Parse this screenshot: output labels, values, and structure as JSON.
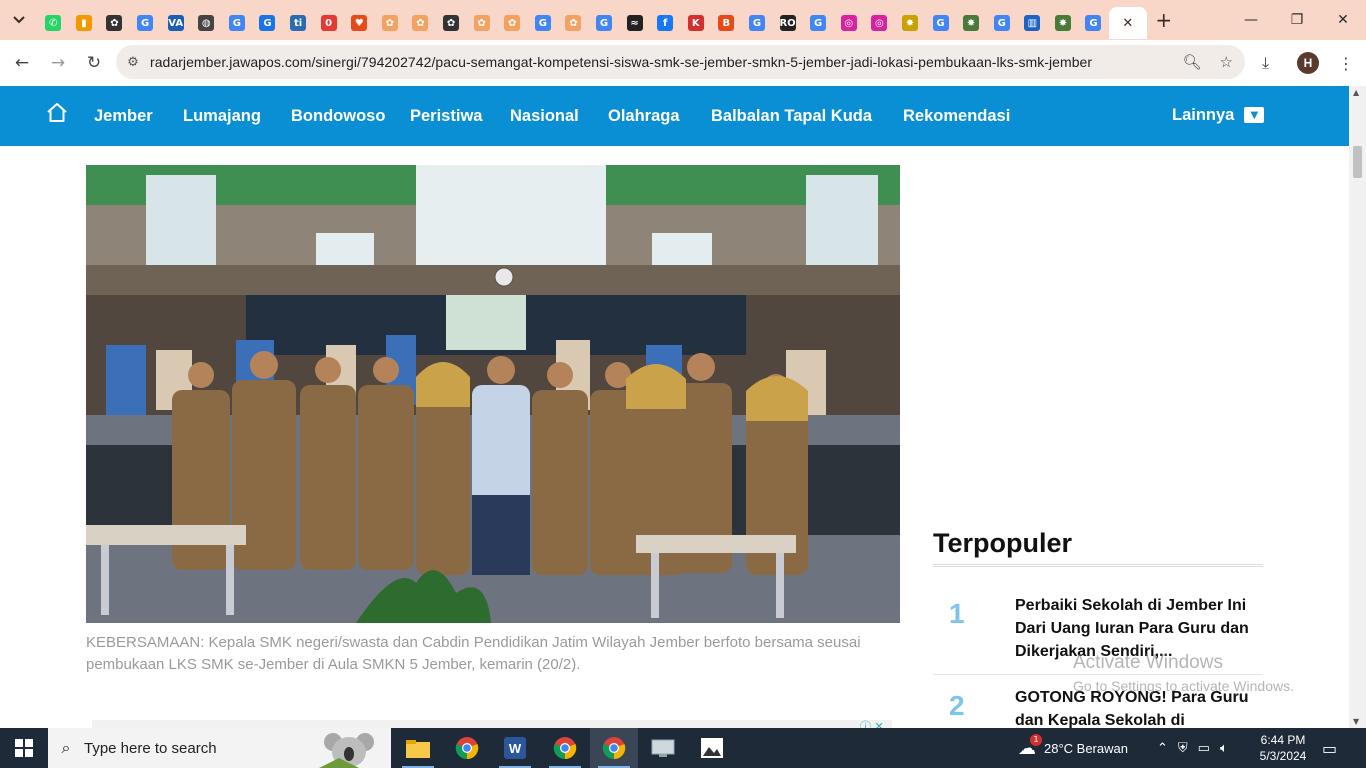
{
  "browser": {
    "tabs": [
      {
        "icon": "whatsapp-icon",
        "color": "#25d366",
        "glyph": "✆"
      },
      {
        "icon": "analytics-icon",
        "color": "#f29900",
        "glyph": "▮"
      },
      {
        "icon": "openai-icon",
        "color": "#333333",
        "glyph": "✿"
      },
      {
        "icon": "google-icon",
        "color": "#4285f4",
        "glyph": "G"
      },
      {
        "icon": "va-icon",
        "color": "#1a5fb4",
        "glyph": "VA"
      },
      {
        "icon": "globe-icon",
        "color": "#444444",
        "glyph": "◍"
      },
      {
        "icon": "google-icon",
        "color": "#4285f4",
        "glyph": "G"
      },
      {
        "icon": "google-icon",
        "color": "#1a73e8",
        "glyph": "G"
      },
      {
        "icon": "ti-icon",
        "color": "#2b6cb0",
        "glyph": "ti"
      },
      {
        "icon": "opera-icon",
        "color": "#e53935",
        "glyph": "0"
      },
      {
        "icon": "heart-icon",
        "color": "#e64a19",
        "glyph": "♥"
      },
      {
        "icon": "paw-icon",
        "color": "#f4a261",
        "glyph": "✿"
      },
      {
        "icon": "paw-icon",
        "color": "#f4a261",
        "glyph": "✿"
      },
      {
        "icon": "openai-icon",
        "color": "#333333",
        "glyph": "✿"
      },
      {
        "icon": "paw-icon",
        "color": "#f4a261",
        "glyph": "✿"
      },
      {
        "icon": "paw-icon",
        "color": "#f4a261",
        "glyph": "✿"
      },
      {
        "icon": "google-icon",
        "color": "#4285f4",
        "glyph": "G"
      },
      {
        "icon": "paw-icon",
        "color": "#f4a261",
        "glyph": "✿"
      },
      {
        "icon": "google-icon",
        "color": "#4285f4",
        "glyph": "G"
      },
      {
        "icon": "wave-icon",
        "color": "#222222",
        "glyph": "≈"
      },
      {
        "icon": "facebook-icon",
        "color": "#1877f2",
        "glyph": "f"
      },
      {
        "icon": "kompas-icon",
        "color": "#d32f2f",
        "glyph": "K"
      },
      {
        "icon": "b-icon",
        "color": "#e64a19",
        "glyph": "B"
      },
      {
        "icon": "google-icon",
        "color": "#4285f4",
        "glyph": "G"
      },
      {
        "icon": "ro-icon",
        "color": "#222222",
        "glyph": "RO"
      },
      {
        "icon": "google-icon",
        "color": "#4285f4",
        "glyph": "G"
      },
      {
        "icon": "instagram-icon",
        "color": "#d6249f",
        "glyph": "◎"
      },
      {
        "icon": "instagram-icon",
        "color": "#d6249f",
        "glyph": "◎"
      },
      {
        "icon": "emblem-icon",
        "color": "#c9a100",
        "glyph": "✸"
      },
      {
        "icon": "google-icon",
        "color": "#4285f4",
        "glyph": "G"
      },
      {
        "icon": "emblem-icon",
        "color": "#4a7a3a",
        "glyph": "✸"
      },
      {
        "icon": "google-icon",
        "color": "#4285f4",
        "glyph": "G"
      },
      {
        "icon": "chart-icon",
        "color": "#1e63c4",
        "glyph": "▥"
      },
      {
        "icon": "emblem-icon",
        "color": "#4a7a3a",
        "glyph": "✸"
      },
      {
        "icon": "google-icon",
        "color": "#4285f4",
        "glyph": "G"
      }
    ],
    "active_tab_close": "✕",
    "new_tab": "+",
    "url": "radarjember.jawapos.com/sinergi/794202742/pacu-semangat-kompetensi-siswa-smk-se-jember-smkn-5-jember-jadi-lokasi-pembukaan-lks-smk-jember",
    "profile_initial": "H"
  },
  "site": {
    "nav": [
      "Jember",
      "Lumajang",
      "Bondowoso",
      "Peristiwa",
      "Nasional",
      "Olahraga",
      "Balbalan Tapal Kuda",
      "Rekomendasi"
    ],
    "more_label": "Lainnya",
    "brand_color": "#0b8fd4"
  },
  "article": {
    "caption": "KEBERSAMAAN: Kepala SMK negeri/swasta dan Cabdin Pendidikan Jatim Wilayah Jember berfoto bersama seusai pembukaan LKS SMK se-Jember di Aula SMKN 5 Jember, kemarin (20/2)."
  },
  "sidebar": {
    "popular_title": "Terpopuler",
    "items": [
      {
        "num": "1",
        "title": "Perbaiki Sekolah di Jember Ini Dari Uang Iuran Para Guru dan Dikerjakan Sendiri,..."
      },
      {
        "num": "2",
        "title": "GOTONG ROYONG! Para Guru dan Kepala Sekolah di"
      }
    ]
  },
  "watermark": {
    "line1": "Activate Windows",
    "line2": "Go to Settings to activate Windows."
  },
  "taskbar": {
    "search_placeholder": "Type here to search",
    "weather": "28°C  Berawan",
    "weather_badge": "1",
    "time": "6:44 PM",
    "date": "5/3/2024"
  }
}
